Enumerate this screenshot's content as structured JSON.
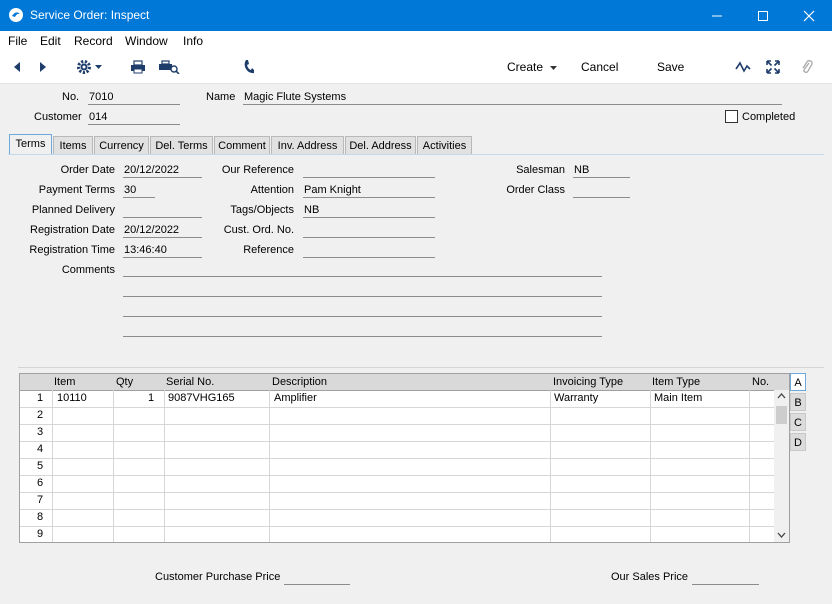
{
  "window": {
    "title": "Service Order: Inspect"
  },
  "menu": [
    "File",
    "Edit",
    "Record",
    "Window",
    "Info"
  ],
  "toolbar": {
    "create": "Create",
    "cancel": "Cancel",
    "save": "Save"
  },
  "header": {
    "no_label": "No.",
    "no_value": "7010",
    "name_label": "Name",
    "name_value": "Magic Flute Systems",
    "customer_label": "Customer",
    "customer_value": "014",
    "completed_label": "Completed"
  },
  "tabs": [
    "Terms",
    "Items",
    "Currency",
    "Del. Terms",
    "Comment",
    "Inv. Address",
    "Del. Address",
    "Activities"
  ],
  "terms": {
    "order_date_label": "Order Date",
    "order_date": "20/12/2022",
    "payment_terms_label": "Payment Terms",
    "payment_terms": "30",
    "planned_delivery_label": "Planned Delivery",
    "planned_delivery": "",
    "registration_date_label": "Registration Date",
    "registration_date": "20/12/2022",
    "registration_time_label": "Registration Time",
    "registration_time": "13:46:40",
    "comments_label": "Comments",
    "our_reference_label": "Our Reference",
    "our_reference": "",
    "attention_label": "Attention",
    "attention": "Pam Knight",
    "tags_label": "Tags/Objects",
    "tags": "NB",
    "cust_ord_label": "Cust. Ord. No.",
    "cust_ord": "",
    "reference_label": "Reference",
    "reference": "",
    "salesman_label": "Salesman",
    "salesman": "NB",
    "order_class_label": "Order Class",
    "order_class": ""
  },
  "grid": {
    "columns": [
      "Item",
      "Qty",
      "Serial No.",
      "Description",
      "Invoicing Type",
      "Item Type",
      "No."
    ],
    "row_numbers": [
      "1",
      "2",
      "3",
      "4",
      "5",
      "6",
      "7",
      "8",
      "9"
    ],
    "rows": [
      {
        "item": "10110",
        "qty": "1",
        "serial": "9087VHG165",
        "description": "Amplifier",
        "invoicing_type": "Warranty",
        "item_type": "Main Item",
        "no": ""
      }
    ],
    "side_tabs": [
      "A",
      "B",
      "C",
      "D"
    ]
  },
  "footer": {
    "customer_purchase_price_label": "Customer Purchase Price",
    "customer_purchase_price": "",
    "our_sales_price_label": "Our Sales Price",
    "our_sales_price": ""
  }
}
